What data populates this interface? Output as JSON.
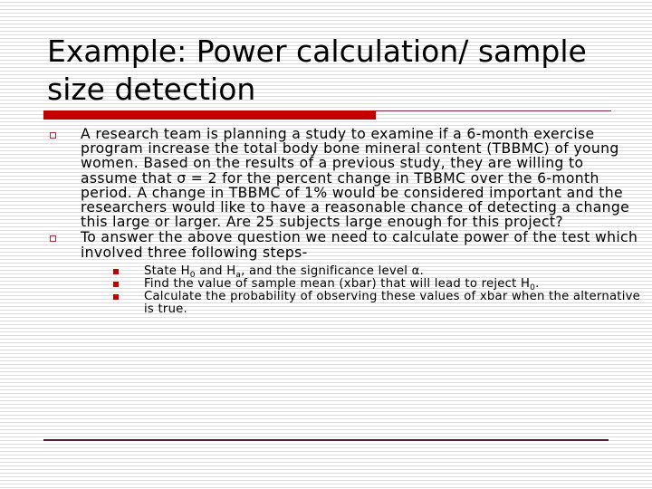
{
  "slide": {
    "title": "Example: Power calculation/ sample size detection",
    "bullets": [
      {
        "icon": "hollow-square-bullet",
        "text": "A research team is planning a study to examine if a 6-month exercise program increase the total body bone mineral content (TBBMC) of young women. Based on the results of a previous study, they are willing to assume that σ = 2 for the percent change in TBBMC over the 6-month period. A change in TBBMC of 1% would be considered important and the researchers would like to have a reasonable chance of detecting a change this large or larger. Are 25 subjects large enough for this project?"
      },
      {
        "icon": "hollow-square-bullet",
        "text": "To answer the above question we need to calculate power of the test which involved three following steps-",
        "sub_bullets": [
          {
            "icon": "filled-square-bullet",
            "parts": [
              "State H",
              "0",
              " and H",
              "a",
              ", and the significance level α."
            ]
          },
          {
            "icon": "filled-square-bullet",
            "parts": [
              "Find the value of sample mean (xbar) that will lead to reject H",
              "0",
              "."
            ]
          },
          {
            "icon": "filled-square-bullet",
            "text": "Calculate the probability of observing these values of xbar when the alternative is true."
          }
        ]
      }
    ]
  },
  "colors": {
    "accent_bar": "#c00000",
    "thin_rule": "#7a1c26",
    "bottom_rule": "#4a1f2a"
  }
}
